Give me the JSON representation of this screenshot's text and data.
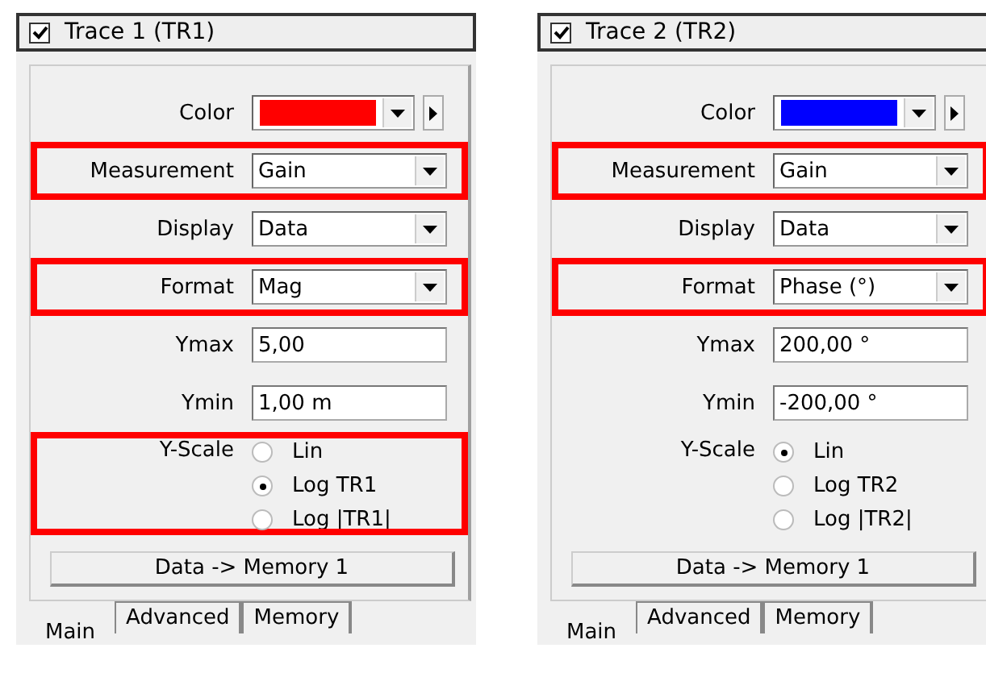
{
  "panels": [
    {
      "title": "Trace 1 (TR1)",
      "enabled": true,
      "rows": [
        {
          "kind": "color",
          "label": "Color",
          "color": "#ff0000",
          "highlighted": false
        },
        {
          "kind": "select",
          "label": "Measurement",
          "value": "Gain",
          "highlighted": true
        },
        {
          "kind": "select",
          "label": "Display",
          "value": "Data",
          "highlighted": false
        },
        {
          "kind": "select",
          "label": "Format",
          "value": "Mag",
          "highlighted": true
        },
        {
          "kind": "text",
          "label": "Ymax",
          "value": "5,00",
          "highlighted": false
        },
        {
          "kind": "text",
          "label": "Ymin",
          "value": "1,00 m",
          "highlighted": false
        },
        {
          "kind": "radio",
          "label": "Y-Scale",
          "highlighted": true,
          "options": [
            {
              "label": "Lin",
              "selected": false
            },
            {
              "label": "Log TR1",
              "selected": true
            },
            {
              "label": "Log |TR1|",
              "selected": false
            }
          ]
        }
      ],
      "button": "Data -> Memory 1",
      "tabs": [
        {
          "label": "Main",
          "selected": true
        },
        {
          "label": "Advanced",
          "selected": false
        },
        {
          "label": "Memory",
          "selected": false
        }
      ]
    },
    {
      "title": "Trace 2 (TR2)",
      "enabled": true,
      "rows": [
        {
          "kind": "color",
          "label": "Color",
          "color": "#0000ff",
          "highlighted": false
        },
        {
          "kind": "select",
          "label": "Measurement",
          "value": "Gain",
          "highlighted": true
        },
        {
          "kind": "select",
          "label": "Display",
          "value": "Data",
          "highlighted": false
        },
        {
          "kind": "select",
          "label": "Format",
          "value": "Phase (°)",
          "highlighted": true
        },
        {
          "kind": "text",
          "label": "Ymax",
          "value": "200,00 °",
          "highlighted": false
        },
        {
          "kind": "text",
          "label": "Ymin",
          "value": "-200,00 °",
          "highlighted": false
        },
        {
          "kind": "radio",
          "label": "Y-Scale",
          "highlighted": false,
          "options": [
            {
              "label": "Lin",
              "selected": true
            },
            {
              "label": "Log TR2",
              "selected": false
            },
            {
              "label": "Log |TR2|",
              "selected": false
            }
          ]
        }
      ],
      "button": "Data -> Memory 1",
      "tabs": [
        {
          "label": "Main",
          "selected": true
        },
        {
          "label": "Advanced",
          "selected": false
        },
        {
          "label": "Memory",
          "selected": false
        }
      ]
    }
  ]
}
